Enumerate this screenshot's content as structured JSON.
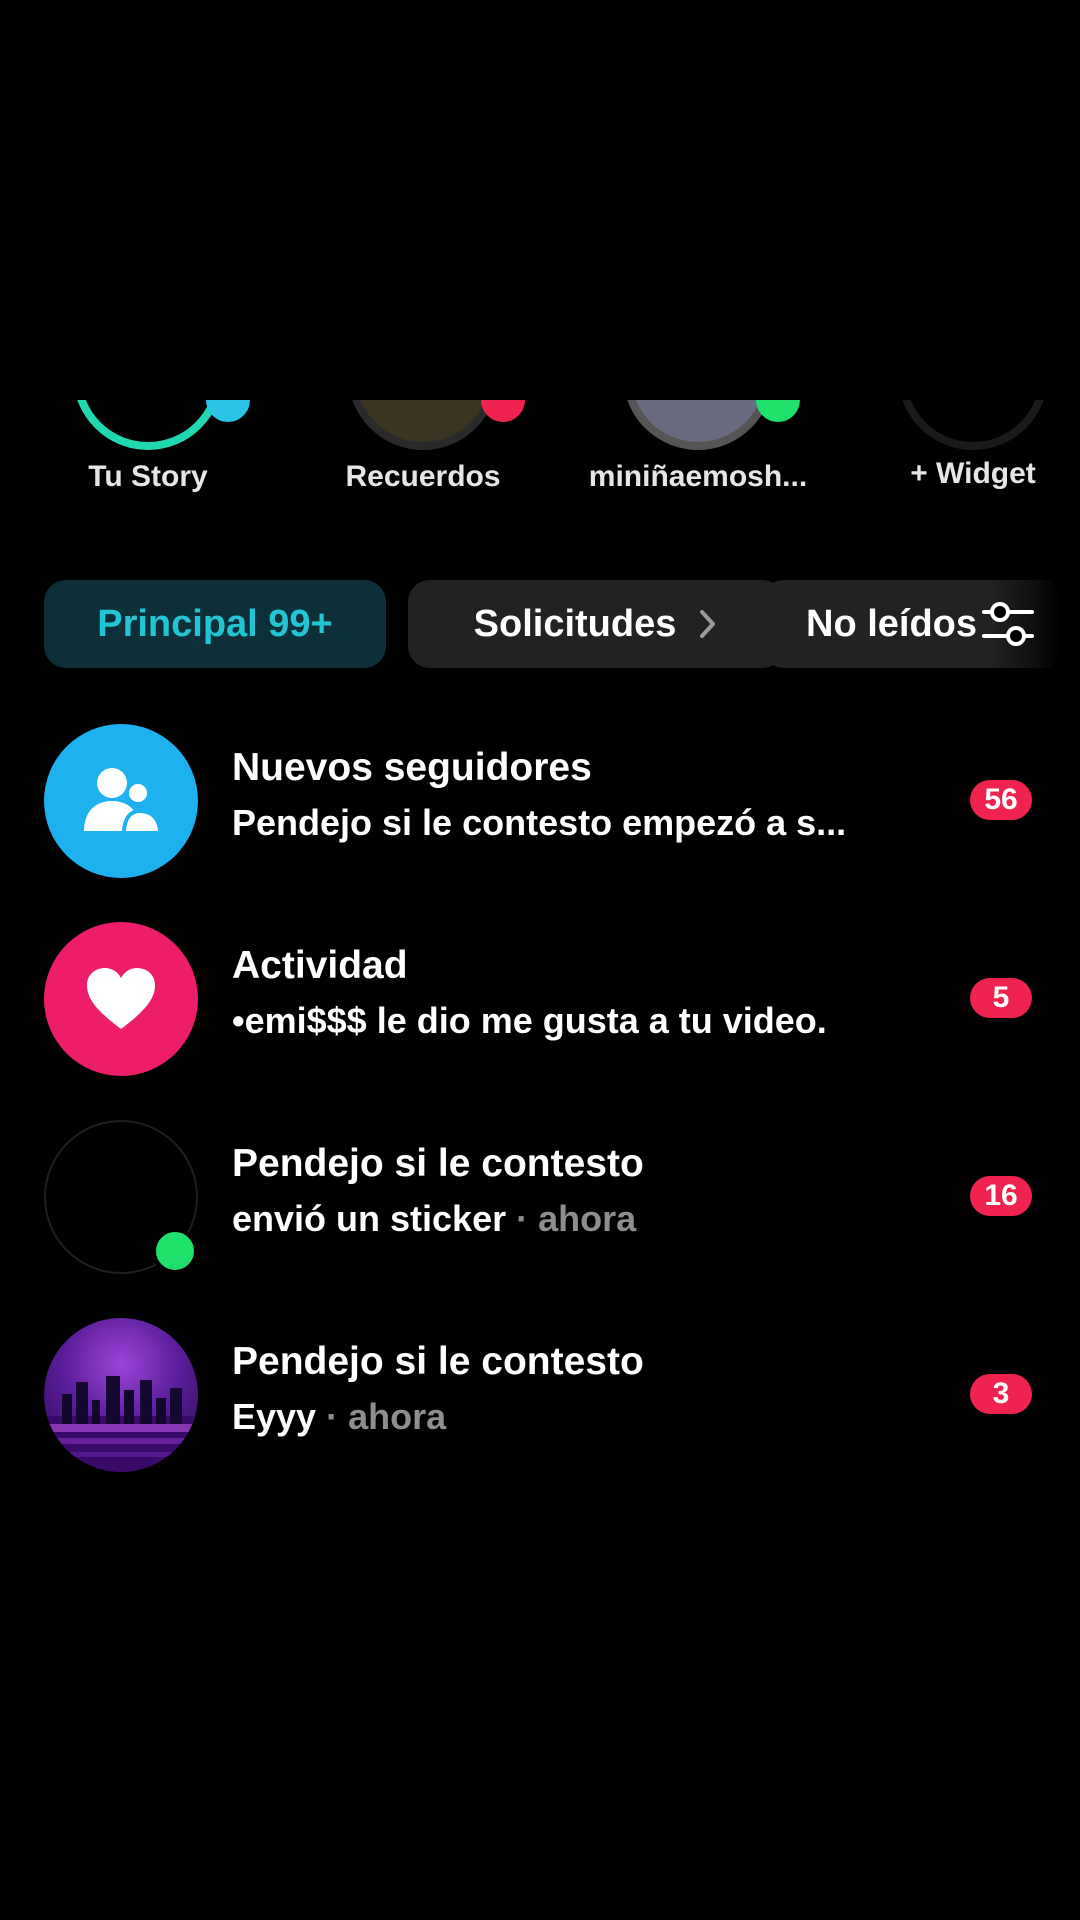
{
  "stories": [
    {
      "label": "Tu Story",
      "ring": "gradient",
      "dot_color": "#2bc3e6"
    },
    {
      "label": "Recuerdos",
      "ring": "image",
      "dot_color": "#f0224f"
    },
    {
      "label": "miniñaemosh...",
      "ring": "grey",
      "dot_color": "#1fe06a"
    },
    {
      "label": "+ Widget",
      "ring": "dark",
      "dot_color": ""
    }
  ],
  "tabs": {
    "primary": "Principal 99+",
    "requests": "Solicitudes",
    "unread": "No leídos"
  },
  "conversations": [
    {
      "title": "Nuevos seguidores",
      "subtitle": "Pendejo si le contesto empezó a s...",
      "meta": "",
      "badge": "56",
      "icon": "followers-icon",
      "avatar_color": "#1db1f0"
    },
    {
      "title": "Actividad",
      "subtitle": "•emi$$$ le dio me gusta a tu video.",
      "meta": "",
      "badge": "5",
      "icon": "heart-icon",
      "avatar_color": "#ee1d6a"
    },
    {
      "title": "Pendejo si le contesto",
      "subtitle": "envió un sticker",
      "meta": " · ahora",
      "badge": "16",
      "icon": "",
      "avatar_color": "#000000",
      "online": true
    },
    {
      "title": "Pendejo si le contesto",
      "subtitle": "Eyyy",
      "meta": " · ahora",
      "badge": "3",
      "icon": "",
      "avatar_color": "#3b1166"
    }
  ],
  "colors": {
    "background": "#000000",
    "accent_cyan": "#22c5d4",
    "badge_red": "#f0224f",
    "online_green": "#1fe06a"
  }
}
